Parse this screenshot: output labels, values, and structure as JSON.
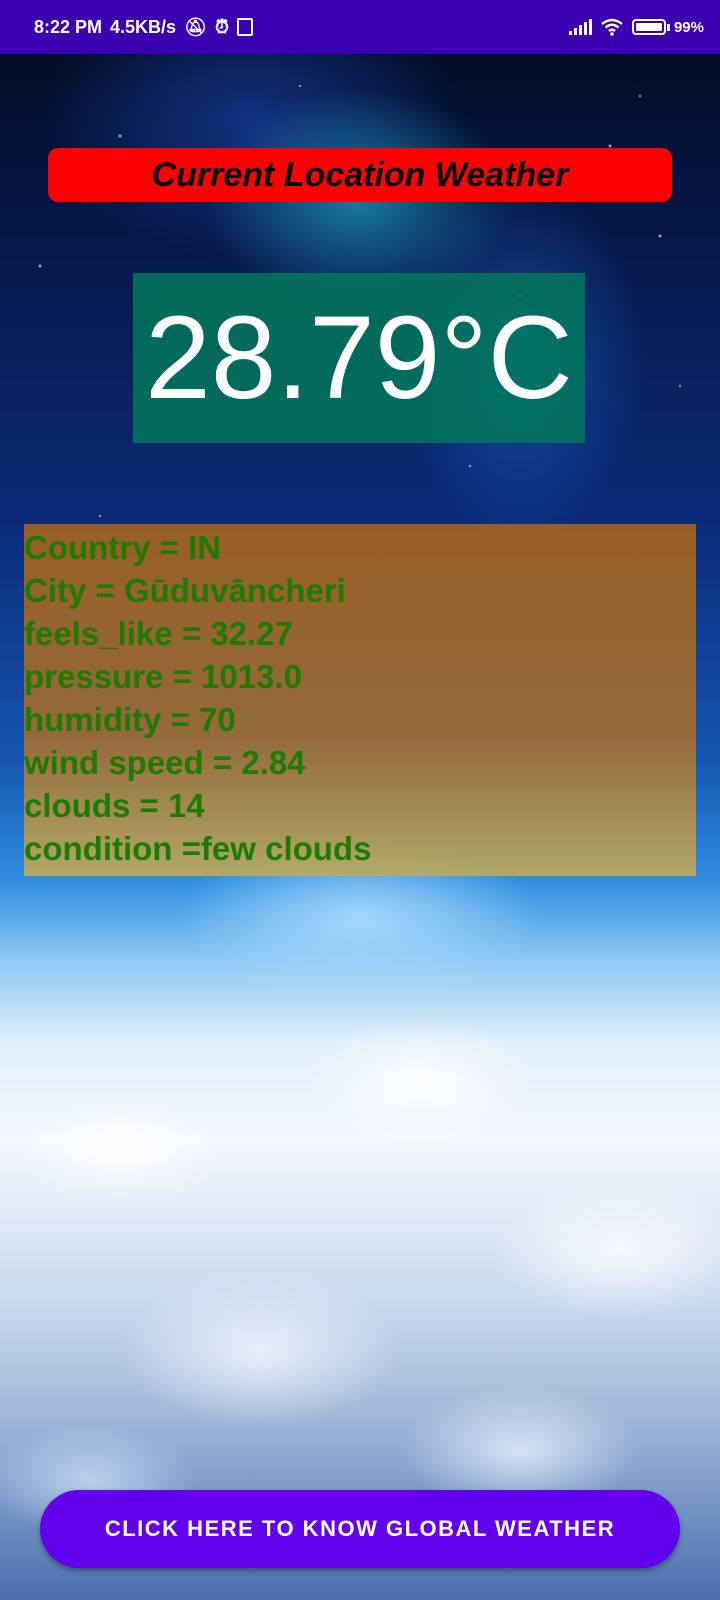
{
  "status_bar": {
    "time": "8:22 PM",
    "network_speed": "4.5KB/s",
    "icons": [
      "mute-bell-icon",
      "alarm-icon",
      "notification-box-icon",
      "signal-icon",
      "wifi-icon",
      "battery-icon"
    ],
    "battery_percent": "99",
    "battery_level": 0.99
  },
  "title": "Current Location Weather",
  "temperature": "28.79°C",
  "details": {
    "country": "Country = IN",
    "city": "City = Gūduvāncheri",
    "feels_like": "feels_like = 32.27",
    "pressure": "pressure = 1013.0",
    "humidity": "humidity = 70",
    "wind_speed": "wind speed = 2.84",
    "clouds": "clouds = 14",
    "condition": "condition =few clouds"
  },
  "global_button_label": "CLICK HERE TO KNOW GLOBAL WEATHER",
  "colors": {
    "status_bar": "#3a00b0",
    "title_background": "#ff0000",
    "temperature_background": "#00785a",
    "details_text": "#1f7a00",
    "button": "#6200ee"
  }
}
